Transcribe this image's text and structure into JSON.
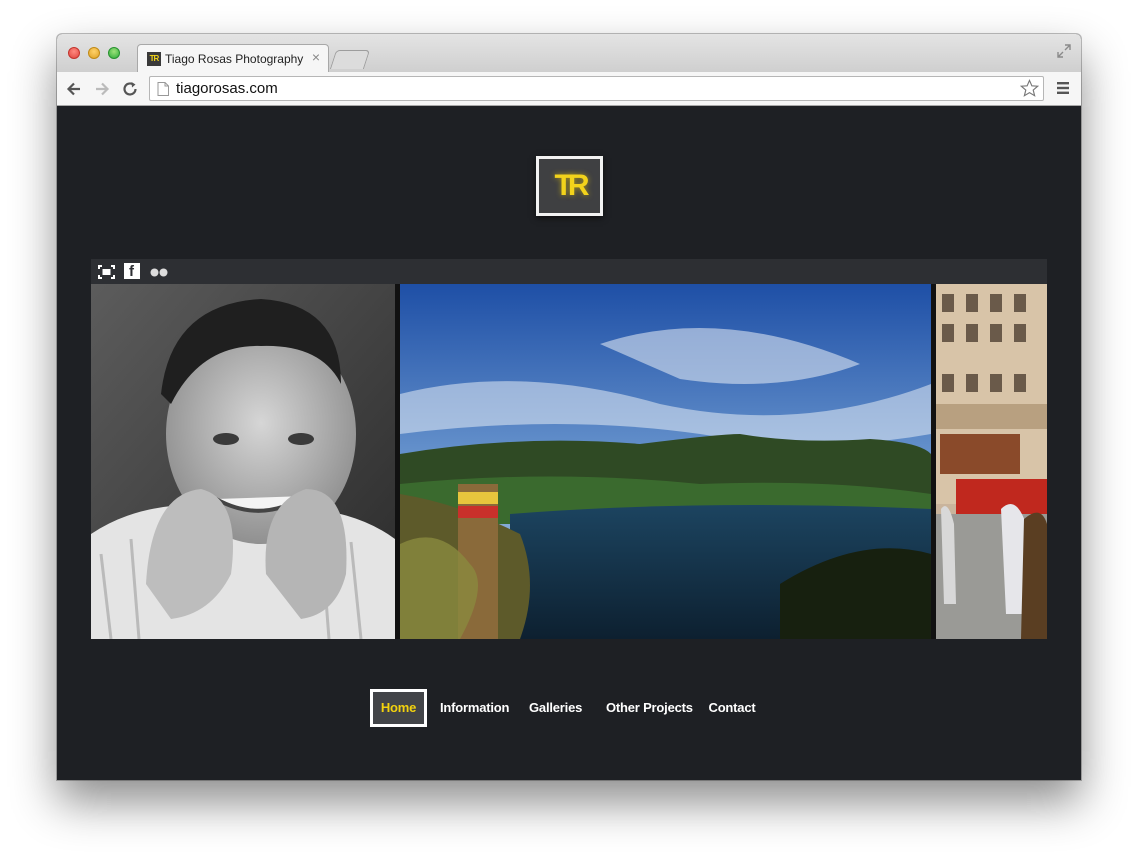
{
  "browser": {
    "tab_title": "Tiago Rosas Photography",
    "tab_close": "×",
    "favicon_text": "TR",
    "url": "tiagorosas.com"
  },
  "site": {
    "logo_text": "TR",
    "accent_color": "#f3d20d",
    "background_color": "#1e2024",
    "gallery_icons": [
      "fullscreen-icon",
      "facebook-icon",
      "flickr-icon"
    ],
    "facebook_glyph": "f",
    "photos": [
      "boy-portrait-bw",
      "crater-lake-landscape",
      "city-street-building"
    ],
    "nav": {
      "home": "Home",
      "information": "Information",
      "galleries": "Galleries",
      "other_projects": "Other Projects",
      "contact": "Contact"
    }
  }
}
